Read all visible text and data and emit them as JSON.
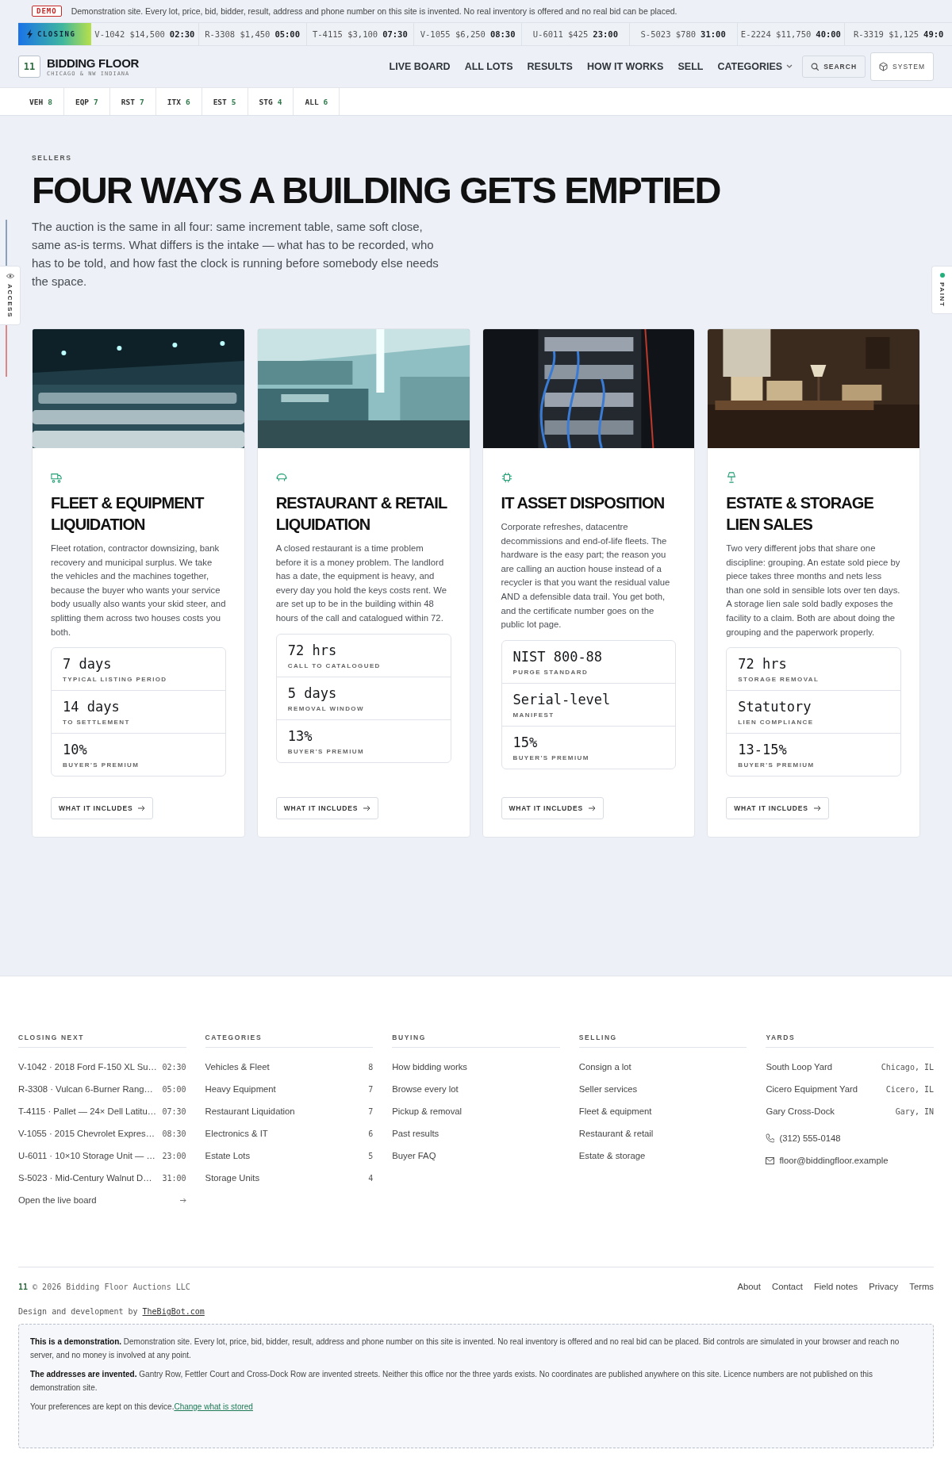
{
  "demo_banner": {
    "badge": "DEMO",
    "text": "Demonstration site. Every lot, price, bid, bidder, result, address and phone number on this site is invented. No real inventory is offered and no real bid can be placed."
  },
  "ticker": {
    "label": "CLOSING",
    "items": [
      {
        "lot": "V-1042",
        "price": "$14,500",
        "time": "02:30"
      },
      {
        "lot": "R-3308",
        "price": "$1,450",
        "time": "05:00"
      },
      {
        "lot": "T-4115",
        "price": "$3,100",
        "time": "07:30"
      },
      {
        "lot": "V-1055",
        "price": "$6,250",
        "time": "08:30"
      },
      {
        "lot": "U-6011",
        "price": "$425",
        "time": "23:00"
      },
      {
        "lot": "S-5023",
        "price": "$780",
        "time": "31:00"
      },
      {
        "lot": "E-2224",
        "price": "$11,750",
        "time": "40:00"
      },
      {
        "lot": "R-3319",
        "price": "$1,125",
        "time": "49:0"
      }
    ]
  },
  "header": {
    "logo_mark": "11",
    "brand": "BIDDING FLOOR",
    "tagline": "CHICAGO & NW INDIANA",
    "nav": [
      {
        "label": "LIVE BOARD",
        "kind": "link"
      },
      {
        "label": "ALL LOTS",
        "kind": "link"
      },
      {
        "label": "RESULTS",
        "kind": "link"
      },
      {
        "label": "HOW IT WORKS",
        "kind": "link"
      },
      {
        "label": "SELL",
        "kind": "link"
      },
      {
        "label": "CATEGORIES",
        "kind": "menu"
      }
    ],
    "search": "SEARCH",
    "system": "SYSTEM"
  },
  "category_tabs": [
    {
      "code": "VEH",
      "count": "8"
    },
    {
      "code": "EQP",
      "count": "7"
    },
    {
      "code": "RST",
      "count": "7"
    },
    {
      "code": "ITX",
      "count": "6"
    },
    {
      "code": "EST",
      "count": "5"
    },
    {
      "code": "STG",
      "count": "4"
    },
    {
      "code": "ALL",
      "count": "6"
    }
  ],
  "side_tabs": [
    {
      "label": "ACCESS",
      "kind": "eye"
    },
    {
      "label": "PAINT",
      "kind": "dot",
      "color": "#22b07d"
    }
  ],
  "hero": {
    "eyebrow": "SELLERS",
    "title": "FOUR WAYS A BUILDING GETS EMPTIED",
    "lead": "The auction is the same in all four: same increment table, same soft close, same as-is terms. What differs is the intake — what has to be recorded, who has to be told, and how fast the clock is running before somebody else needs the space."
  },
  "cards": [
    {
      "kind": "fleet",
      "title": "FLEET & EQUIPMENT LIQUIDATION",
      "text": "Fleet rotation, contractor downsizing, bank recovery and municipal surplus. We take the vehicles and the machines together, because the buyer who wants your service body usually also wants your skid steer, and splitting them across two houses costs you both.",
      "stats": [
        {
          "value": "7 days",
          "label": "TYPICAL LISTING PERIOD"
        },
        {
          "value": "14 days",
          "label": "TO SETTLEMENT"
        },
        {
          "value": "10%",
          "label": "BUYER'S PREMIUM"
        }
      ],
      "button": "WHAT IT INCLUDES"
    },
    {
      "kind": "restaurant",
      "title": "RESTAURANT & RETAIL LIQUIDATION",
      "text": "A closed restaurant is a time problem before it is a money problem. The landlord has a date, the equipment is heavy, and every day you hold the keys costs rent. We are set up to be in the building within 48 hours of the call and catalogued within 72.",
      "stats": [
        {
          "value": "72 hrs",
          "label": "CALL TO CATALOGUED"
        },
        {
          "value": "5 days",
          "label": "REMOVAL WINDOW"
        },
        {
          "value": "13%",
          "label": "BUYER'S PREMIUM"
        }
      ],
      "button": "WHAT IT INCLUDES"
    },
    {
      "kind": "it",
      "title": "IT ASSET DISPOSITION",
      "text": "Corporate refreshes, datacentre decommissions and end-of-life fleets. The hardware is the easy part; the reason you are calling an auction house instead of a recycler is that you want the residual value AND a defensible data trail. You get both, and the certificate number goes on the public lot page.",
      "stats": [
        {
          "value": "NIST 800-88",
          "label": "PURGE STANDARD"
        },
        {
          "value": "Serial-level",
          "label": "MANIFEST"
        },
        {
          "value": "15%",
          "label": "BUYER'S PREMIUM"
        }
      ],
      "button": "WHAT IT INCLUDES"
    },
    {
      "kind": "estate",
      "title": "ESTATE & STORAGE LIEN SALES",
      "text": "Two very different jobs that share one discipline: grouping. An estate sold piece by piece takes three months and nets less than one sold in sensible lots over ten days. A storage lien sale sold badly exposes the facility to a claim. Both are about doing the grouping and the paperwork properly.",
      "stats": [
        {
          "value": "72 hrs",
          "label": "STORAGE REMOVAL"
        },
        {
          "value": "Statutory",
          "label": "LIEN COMPLIANCE"
        },
        {
          "value": "13-15%",
          "label": "BUYER'S PREMIUM"
        }
      ],
      "button": "WHAT IT INCLUDES"
    }
  ],
  "footer": {
    "closing_next": {
      "heading": "CLOSING NEXT",
      "items": [
        {
          "text": "V-1042 · 2018 Ford F-150 XL Su…",
          "time": "02:30"
        },
        {
          "text": "R-3308 · Vulcan 6-Burner Rang…",
          "time": "05:00"
        },
        {
          "text": "T-4115 · Pallet — 24× Dell Latitu…",
          "time": "07:30"
        },
        {
          "text": "V-1055 · 2015 Chevrolet Expres…",
          "time": "08:30"
        },
        {
          "text": "U-6011 · 10×10 Storage Unit — …",
          "time": "23:00"
        },
        {
          "text": "S-5023 · Mid-Century Walnut D…",
          "time": "31:00"
        }
      ],
      "more": "Open the live board"
    },
    "categories": {
      "heading": "CATEGORIES",
      "items": [
        {
          "label": "Vehicles & Fleet",
          "count": "8"
        },
        {
          "label": "Heavy Equipment",
          "count": "7"
        },
        {
          "label": "Restaurant Liquidation",
          "count": "7"
        },
        {
          "label": "Electronics & IT",
          "count": "6"
        },
        {
          "label": "Estate Lots",
          "count": "5"
        },
        {
          "label": "Storage Units",
          "count": "4"
        }
      ]
    },
    "buying": {
      "heading": "BUYING",
      "links": [
        "How bidding works",
        "Browse every lot",
        "Pickup & removal",
        "Past results",
        "Buyer FAQ"
      ]
    },
    "selling": {
      "heading": "SELLING",
      "links": [
        "Consign a lot",
        "Seller services",
        "Fleet & equipment",
        "Restaurant & retail",
        "Estate & storage"
      ]
    },
    "yards": {
      "heading": "YARDS",
      "items": [
        {
          "name": "South Loop Yard",
          "city": "Chicago, IL"
        },
        {
          "name": "Cicero Equipment Yard",
          "city": "Cicero, IL"
        },
        {
          "name": "Gary Cross-Dock",
          "city": "Gary, IN"
        }
      ],
      "phone": "(312) 555-0148",
      "email": "floor@biddingfloor.example"
    },
    "mark": "11",
    "copyright": "© 2026 Bidding Floor Auctions LLC",
    "links": [
      "About",
      "Contact",
      "Field notes",
      "Privacy",
      "Terms"
    ],
    "credit": {
      "prefix": "Design and development by",
      "link": "TheBigBot.com"
    },
    "notice": [
      "**This is a demonstration.** Demonstration site. Every lot, price, bid, bidder, result, address and phone number on this site is invented. No real inventory is offered and no real bid can be placed. Bid controls are simulated in your browser and reach no server, and no money is involved at any point.",
      "**The addresses are invented.** Gantry Row, Fettler Court and Cross-Dock Row are invented streets. Neither this office nor the three yards exists. No coordinates are published anywhere on this site. Licence numbers are not published on this demonstration site."
    ],
    "preferences": {
      "text": "Your preferences are kept on this device.",
      "link": "Change what is stored"
    }
  }
}
